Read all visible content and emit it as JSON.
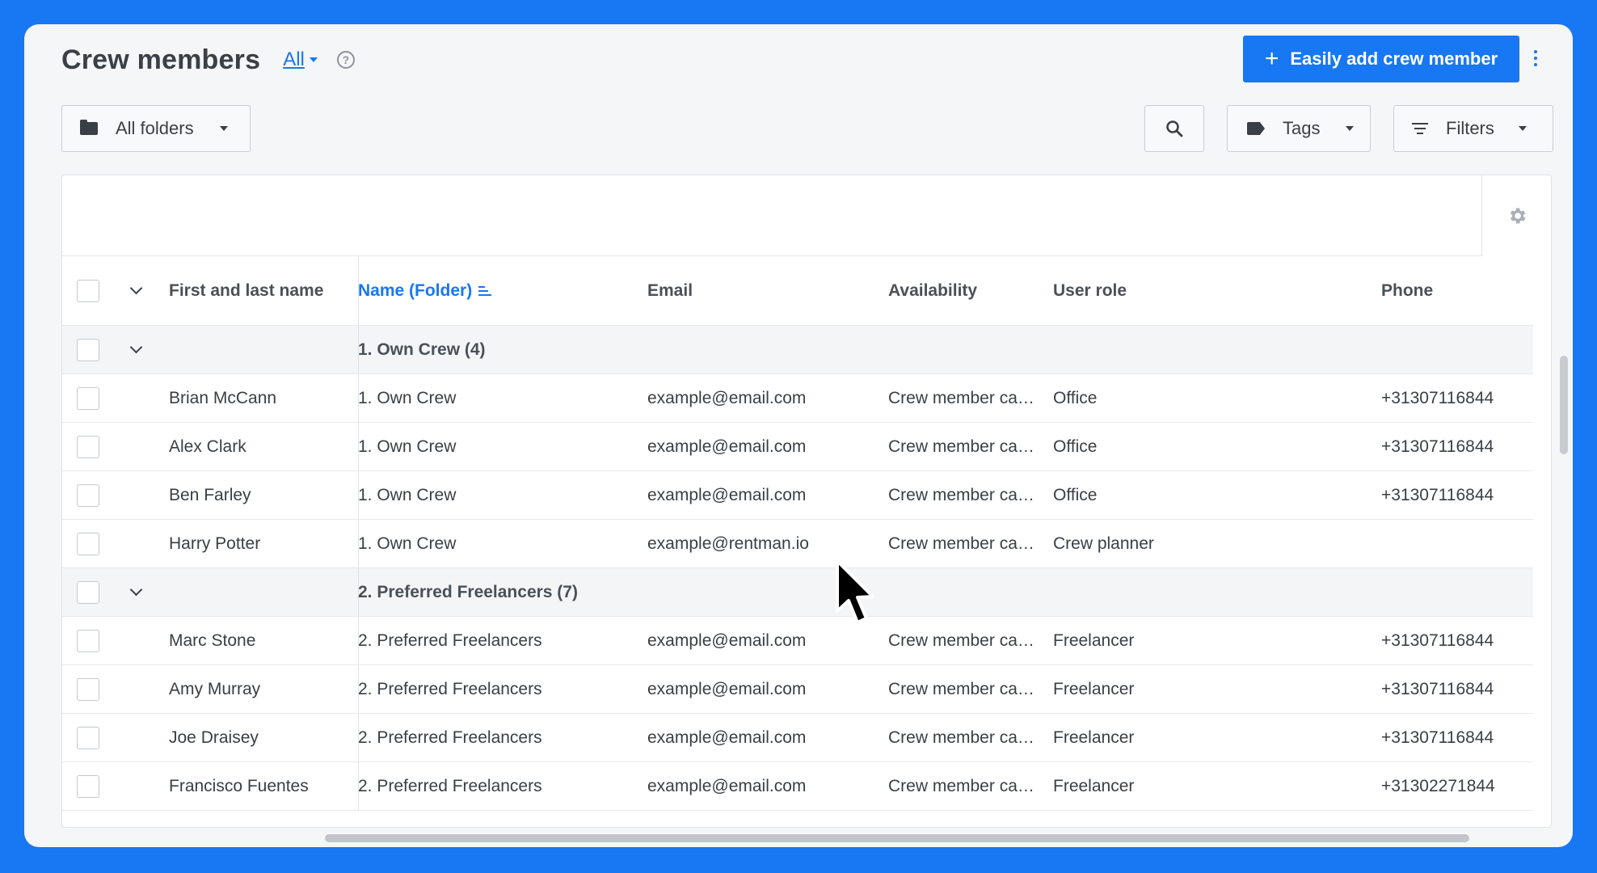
{
  "header": {
    "title": "Crew members",
    "view_filter": "All",
    "help_glyph": "?",
    "add_button": "Easily add crew member",
    "add_glyph": "+"
  },
  "toolbar": {
    "folders": "All folders",
    "tags": "Tags",
    "filters": "Filters"
  },
  "table": {
    "columns": {
      "name": "First and last name",
      "folder": "Name (Folder)",
      "email": "Email",
      "availability": "Availability",
      "role": "User role",
      "phone": "Phone"
    },
    "groups": [
      {
        "label": "1. Own Crew (4)",
        "rows": [
          {
            "name": "Brian McCann",
            "folder": "1. Own Crew",
            "email": "example@email.com",
            "availability": "Crew member ca…",
            "role": "Office",
            "phone": "+31307116844"
          },
          {
            "name": "Alex Clark",
            "folder": "1. Own Crew",
            "email": "example@email.com",
            "availability": "Crew member ca…",
            "role": "Office",
            "phone": "+31307116844"
          },
          {
            "name": "Ben Farley",
            "folder": "1. Own Crew",
            "email": "example@email.com",
            "availability": "Crew member ca…",
            "role": "Office",
            "phone": "+31307116844"
          },
          {
            "name": "Harry Potter",
            "folder": "1. Own Crew",
            "email": "example@rentman.io",
            "availability": "Crew member ca…",
            "role": "Crew planner",
            "phone": ""
          }
        ]
      },
      {
        "label": "2. Preferred Freelancers (7)",
        "rows": [
          {
            "name": "Marc Stone",
            "folder": "2. Preferred Freelancers",
            "email": "example@email.com",
            "availability": "Crew member ca…",
            "role": "Freelancer",
            "phone": "+31307116844"
          },
          {
            "name": "Amy Murray",
            "folder": "2. Preferred Freelancers",
            "email": "example@email.com",
            "availability": "Crew member ca…",
            "role": "Freelancer",
            "phone": "+31307116844"
          },
          {
            "name": "Joe Draisey",
            "folder": "2. Preferred Freelancers",
            "email": "example@email.com",
            "availability": "Crew member ca…",
            "role": "Freelancer",
            "phone": "+31307116844"
          },
          {
            "name": "Francisco Fuentes",
            "folder": "2. Preferred Freelancers",
            "email": "example@email.com",
            "availability": "Crew member ca…",
            "role": "Freelancer",
            "phone": "+31302271844"
          }
        ]
      }
    ]
  },
  "colors": {
    "accent": "#1877f2",
    "background": "#1877f2"
  },
  "icons": [
    "folder-icon",
    "search-icon",
    "tag-icon",
    "filter-icon",
    "gear-icon",
    "help-icon",
    "kebab-menu-icon",
    "chevron-down-icon",
    "sort-icon",
    "mouse-cursor-icon"
  ]
}
